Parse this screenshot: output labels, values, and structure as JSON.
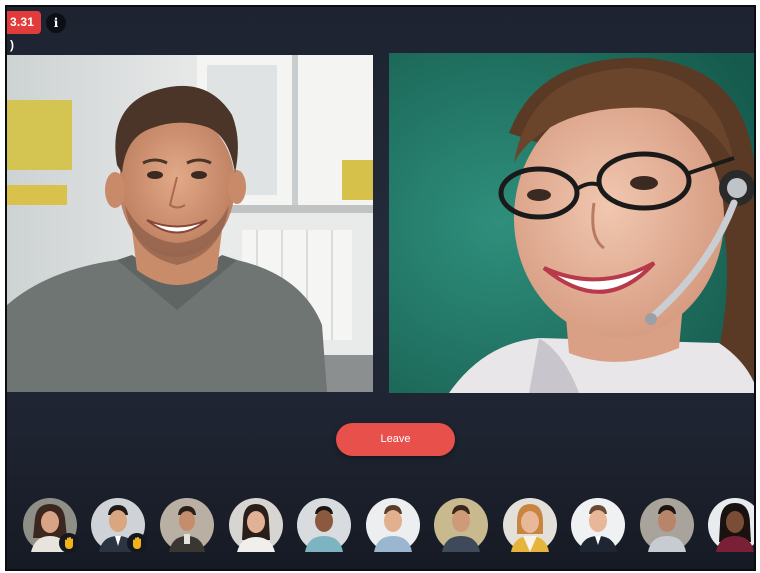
{
  "call": {
    "timer_badge": "3.31 )",
    "info_icon": "i",
    "leave_label": "Leave",
    "accent_color": "#e8504c"
  },
  "video_tiles": [
    {
      "name": "video-tile-man",
      "icon": "smiling-man-video"
    },
    {
      "name": "video-tile-woman-headset",
      "icon": "woman-with-headset-video"
    }
  ],
  "participants": [
    {
      "id": "participant-1",
      "hand_raised": true
    },
    {
      "id": "participant-2",
      "hand_raised": true
    },
    {
      "id": "participant-3",
      "hand_raised": false
    },
    {
      "id": "participant-4",
      "hand_raised": false
    },
    {
      "id": "participant-5",
      "hand_raised": false
    },
    {
      "id": "participant-6",
      "hand_raised": false
    },
    {
      "id": "participant-7",
      "hand_raised": false
    },
    {
      "id": "participant-8",
      "hand_raised": false
    },
    {
      "id": "participant-9",
      "hand_raised": false
    },
    {
      "id": "participant-10",
      "hand_raised": false
    },
    {
      "id": "participant-11",
      "hand_raised": false
    }
  ]
}
